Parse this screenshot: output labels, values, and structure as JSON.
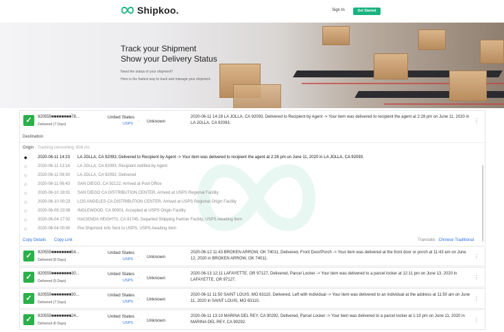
{
  "nav": {
    "brand": "Shipkoo.",
    "signin": "Sign In",
    "cta": "Get Started"
  },
  "hero": {
    "title_line1": "Track your Shipment",
    "title_line2": "Show your Delivery Status",
    "sub_line1": "Need the status of your shipment?",
    "sub_line2": "Here is the fastest way to track and manage your shipment."
  },
  "expanded": {
    "tracking": "920559■■■■■■■■78...",
    "status": "Delivered (7 Days)",
    "country": "United States",
    "carrier": "USPS",
    "unknown": "Unknown",
    "event": "2020-06-11 14:28 LA JOLLA, CA 92093, Delivered to Recipient by Agent -> Your item was delivered to recipient the agent at 2:28 pm on June 11, 2020 in LA JOLLA, CA 92093.",
    "destination": "Destination",
    "origin": "Origin",
    "origin_note": "Tracking consuming: 608 ms",
    "events": [
      {
        "dt": "2020-06-11 14:23",
        "text": "LA JOLLA, CA 92093, Delivered to Recipient by Agent -> Your item was delivered to recipient the agent at 2:28 pm on June 11, 2020 in LA JOLLA, CA 92093."
      },
      {
        "dt": "2020-06-11 13:14",
        "text": "LA JOLLA, CA 92093, Recipient notified by Agent"
      },
      {
        "dt": "2020-06-11 09:30",
        "text": "LA JOLLA, CA 92092, Delivered"
      },
      {
        "dt": "2020-06-11 06:43",
        "text": "SAN DIEGO, CA 92122, Arrived at Post Office"
      },
      {
        "dt": "2020-06-10 18:01",
        "text": "SAN DIEGO CA DISTRIBUTION CENTER, Arrived at USPS Regional Facility"
      },
      {
        "dt": "2020-06-10 00:23",
        "text": "LOS ANGELES CA DISTRIBUTION CENTER, Arrived at USPS Regional Origin Facility"
      },
      {
        "dt": "2020-06-09 23:08",
        "text": "INGLEWOOD, CA 90301, Accepted at USPS Origin Facility"
      },
      {
        "dt": "2020-06-04 17:02",
        "text": "HACIENDA HEIGHTS, CA 91745, Departed Shipping Partner Facility, USPS Awaiting Item"
      },
      {
        "dt": "2020-06-04 00:00",
        "text": "Pre-Shipment Info Sent to USPS, USPS Awaiting Item"
      }
    ],
    "copy_details": "Copy Details",
    "copy_link": "Copy Link",
    "translate": "Translate:",
    "lang": "Chinese Traditional"
  },
  "cards": [
    {
      "tracking": "920559■■■■■■■■54...",
      "status": "Delivered (8 Days)",
      "country": "United States",
      "carrier": "USPS",
      "unknown": "Unknown",
      "event": "2020-06-12 11:43 BROKEN ARROW, OK 74011, Delivered, Front Door/Porch -> Your item was delivered at the front door or porch at 11:43 am on June 12, 2020 in BROKEN ARROW, OK 74011."
    },
    {
      "tracking": "920559■■■■■■■■30...",
      "status": "Delivered (9 Days)",
      "country": "United States",
      "carrier": "USPS",
      "unknown": "Unknown",
      "event": "2020-06-13 12:11 LAFAYETTE, OR 97127, Delivered, Parcel Locker -> Your item was delivered to a parcel locker at 12:11 pm on June 13, 2020 in LAFAYETTE, OR 97127."
    },
    {
      "tracking": "920559■■■■■■■■30...",
      "status": "Delivered (7 Days)",
      "country": "United States",
      "carrier": "USPS",
      "unknown": "Unknown",
      "event": "2020-06-11 11:50 SAINT LOUIS, MO 63110, Delivered, Left with Individual -> Your item was delivered to an individual at the address at 11:50 am on June 11, 2020 in SAINT LOUIS, MO 63110."
    },
    {
      "tracking": "920559■■■■■■■■24...",
      "status": "Delivered (6 Days)",
      "country": "United States",
      "carrier": "USPS",
      "unknown": "Unknown",
      "event": "2020-06-11 13:10 MARINA DEL REY, CA 90292, Delivered, Parcel Locker -> Your item was delivered to a parcel locker at 1:10 pm on June 11, 2020 in MARINA DEL REY, CA 90292."
    }
  ],
  "colors": {
    "accent": "#19b37e",
    "check": "#2bb04a",
    "link": "#2a6fdb"
  }
}
